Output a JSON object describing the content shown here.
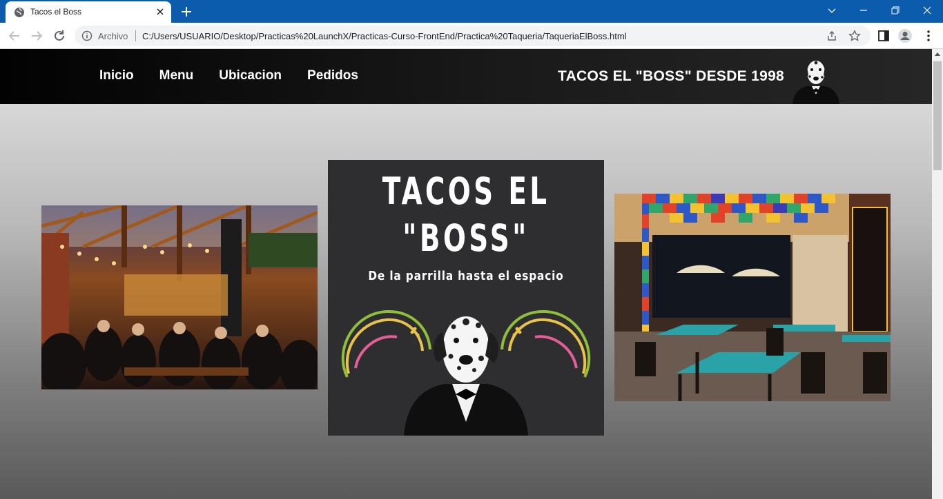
{
  "browser": {
    "tab_title": "Tacos el Boss",
    "omnibox_scheme": "Archivo",
    "url": "C:/Users/USUARIO/Desktop/Practicas%20LaunchX/Practicas-Curso-FrontEnd/Practica%20Taqueria/TaqueriaElBoss.html",
    "tabbar_color": "#0b5cad"
  },
  "site": {
    "nav": [
      "Inicio",
      "Menu",
      "Ubicacion",
      "Pedidos"
    ],
    "brand": "TACOS EL \"BOSS\" DESDE 1998",
    "poster": {
      "line1": "TACOS EL",
      "line2": "\"BOSS\"",
      "subtitle": "De la parrilla hasta el espacio"
    }
  },
  "icons": [
    "globe-icon",
    "close-icon",
    "plus-icon",
    "chevron-down-icon",
    "minimize-icon",
    "restore-icon",
    "close-window-icon",
    "back-icon",
    "forward-icon",
    "reload-icon",
    "info-icon",
    "share-icon",
    "star-icon",
    "side-panel-icon",
    "profile-icon",
    "kebab-menu-icon"
  ]
}
